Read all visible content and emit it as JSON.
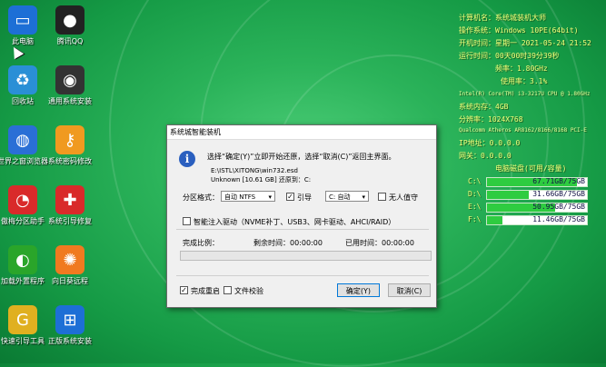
{
  "desktop": {
    "icons": [
      {
        "label": "此电脑",
        "glyph": "▭",
        "color": "#1d6fd6"
      },
      {
        "label": "腾讯QQ",
        "glyph": "●",
        "color": "#222222"
      },
      {
        "label": "回收站",
        "glyph": "♻",
        "color": "#2a8fd6"
      },
      {
        "label": "通用系统安装",
        "glyph": "◉",
        "color": "#333333"
      },
      {
        "label": "世界之窗浏览器",
        "glyph": "◍",
        "color": "#2a6fd6"
      },
      {
        "label": "系统密码修改",
        "glyph": "⚷",
        "color": "#f09a20"
      },
      {
        "label": "傲梅分区助手",
        "glyph": "◔",
        "color": "#d92a2a"
      },
      {
        "label": "系统引导修复",
        "glyph": "✚",
        "color": "#d92a2a"
      },
      {
        "label": "加载外置程序",
        "glyph": "◐",
        "color": "#2aa52a"
      },
      {
        "label": "向日葵远程",
        "glyph": "✺",
        "color": "#f07a20"
      },
      {
        "label": "快速引导工具",
        "glyph": "G",
        "color": "#e0b020"
      },
      {
        "label": "正版系统安装",
        "glyph": "⊞",
        "color": "#1d6fd6"
      }
    ]
  },
  "sysinfo": {
    "computer_name_label": "计算机名：",
    "computer_name": "系统城装机大师",
    "os_label": "操作系统：",
    "os": "Windows 10PE(64bit)",
    "boot_time_label": "开机时间：",
    "boot_time": "星期一 2021-05-24 21:52",
    "run_time_label": "运行时间：",
    "run_time": "00天00时39分39秒",
    "freq_label": "频率：",
    "freq": "1.80GHz",
    "usage_label": "使用率：",
    "usage": "3.1%",
    "cpu": "Intel(R) Core(TM) i3-3217U CPU @ 1.80GHz",
    "memory_label": "系统内存：",
    "memory": "4GB",
    "resolution_label": "分辨率：",
    "resolution": "1024X768",
    "nic": "Qualcomm Atheros AR8162/8166/8168 PCI-E",
    "ip_label": "IP地址：",
    "ip": "0.0.0.0",
    "gateway_label": "网关：",
    "gateway": "0.0.0.0",
    "disk_title": "电脑磁盘(可用/容量)",
    "disks": [
      {
        "drive": "C:\\",
        "text": "67.71GB/75GB",
        "fill": 0.9
      },
      {
        "drive": "D:\\",
        "text": "31.66GB/75GB",
        "fill": 0.42
      },
      {
        "drive": "E:\\",
        "text": "50.95GB/75GB",
        "fill": 0.68
      },
      {
        "drive": "F:\\",
        "text": "11.46GB/75GB",
        "fill": 0.15
      }
    ]
  },
  "dialog": {
    "title": "系统城智能装机",
    "message": "选择“确定(Y)”立即开始还原，选择“取消(C)”返回主界面。",
    "image_path": "E:\\ISTL\\XITONG\\win732.esd",
    "unknown_info": "Unknown [10.61 GB]",
    "restore_to_label": "还原到：",
    "restore_to": "C:",
    "partition_format_label": "分区格式：",
    "partition_format_value": "自动 NTFS",
    "boot_label": "引导",
    "boot_value": "C: 自动",
    "boot_checked": "✓",
    "unattended_label": "无人值守",
    "driver_label": "智能注入驱动（NVME补丁、USB3、网卡驱动、AHCI/RAID）",
    "progress_label": "完成比例：",
    "remaining_label": "剩余时间：",
    "remaining": "00:00:00",
    "elapsed_label": "已用时间：",
    "elapsed": "00:00:00",
    "progress_value": 0,
    "reboot_label": "完成重启",
    "reboot_checked": "✓",
    "verify_label": "文件校验",
    "ok_label": "确定(Y)",
    "cancel_label": "取消(C)"
  }
}
